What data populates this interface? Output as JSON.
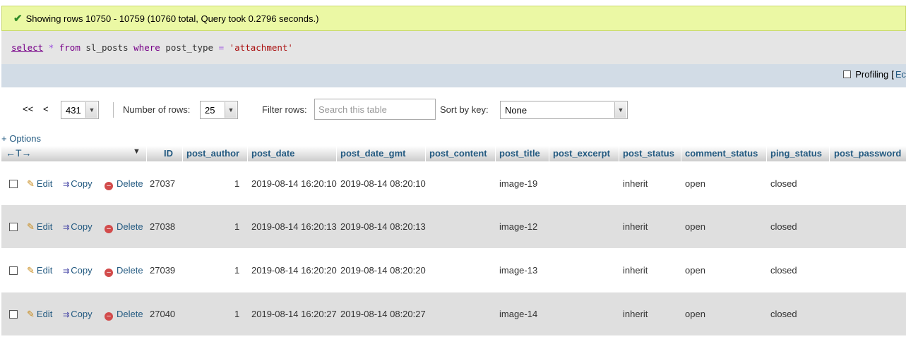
{
  "message": {
    "text": "Showing rows 10750 - 10759 (10760 total, Query took 0.2796 seconds.)"
  },
  "sql": {
    "select": "select",
    "star": "*",
    "from": "from",
    "table": "sl_posts",
    "where": "where",
    "col": "post_type",
    "eq": "=",
    "val": "'attachment'"
  },
  "profiling": {
    "label": "Profiling",
    "bracket": "[",
    "edit": "Ec"
  },
  "nav": {
    "first": "<<",
    "prev": "<",
    "page": "431",
    "rows_label": "Number of rows:",
    "rows_value": "25",
    "filter_label": "Filter rows:",
    "filter_placeholder": "Search this table",
    "sort_label": "Sort by key:",
    "sort_value": "None"
  },
  "options_label": "+ Options",
  "header": {
    "arrows": "←T→",
    "columns": [
      "ID",
      "post_author",
      "post_date",
      "post_date_gmt",
      "post_content",
      "post_title",
      "post_excerpt",
      "post_status",
      "comment_status",
      "ping_status",
      "post_password"
    ]
  },
  "actions": {
    "edit": "Edit",
    "copy": "Copy",
    "delete": "Delete"
  },
  "rows": [
    {
      "id": "27037",
      "author": "1",
      "date": "2019-08-14 16:20:10",
      "gmt": "2019-08-14 08:20:10",
      "title": "image-19",
      "status": "inherit",
      "comment": "open",
      "ping": "closed"
    },
    {
      "id": "27038",
      "author": "1",
      "date": "2019-08-14 16:20:13",
      "gmt": "2019-08-14 08:20:13",
      "title": "image-12",
      "status": "inherit",
      "comment": "open",
      "ping": "closed"
    },
    {
      "id": "27039",
      "author": "1",
      "date": "2019-08-14 16:20:20",
      "gmt": "2019-08-14 08:20:20",
      "title": "image-13",
      "status": "inherit",
      "comment": "open",
      "ping": "closed"
    },
    {
      "id": "27040",
      "author": "1",
      "date": "2019-08-14 16:20:27",
      "gmt": "2019-08-14 08:20:27",
      "title": "image-14",
      "status": "inherit",
      "comment": "open",
      "ping": "closed"
    }
  ]
}
